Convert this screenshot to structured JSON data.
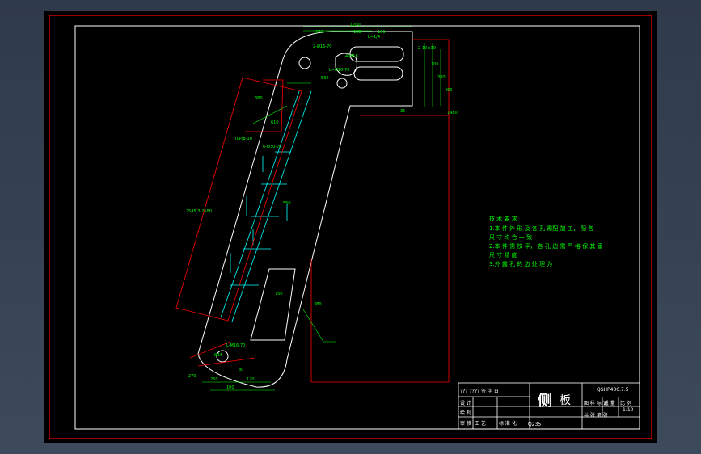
{
  "colors": {
    "sheet_background": "#000000",
    "frame": "#ff0000",
    "outline": "#ffffff",
    "dimension": "#00ff00",
    "hidden_line": "#00ffff",
    "viewport": "#3d4a5c"
  },
  "notes": {
    "heading": "技 术 要 求",
    "lines": [
      "1.本 件 外 形 及 各 孔 需配 加 工， 配 各",
      "尺 寸 均 合 一 致",
      "2.本 件 需 校 平， 各 孔 边 需 严 格 保 其 垂",
      "尺 寸 精 度",
      "3.外 露 孔 的 边 处 理 为"
    ]
  },
  "title_block": {
    "drawing_number": "QSHP400.7.5",
    "part_name_char1": "侧",
    "part_name_char2": "板",
    "label_stage": "图 样 标 记",
    "label_weight": "重 量",
    "label_scale": "比 例",
    "scale": "1:10",
    "sheet_of": "共 张 第 张",
    "design": "设 计",
    "draw": "绘 制",
    "check": "审 核",
    "process": "工 艺",
    "standard": "标 准 化",
    "material": "Q235",
    "misc": "??? ???? 签 字 日"
  },
  "dimensions": [
    "1200",
    "270",
    "188",
    "150",
    "L=1/4",
    "2-10×30",
    "100",
    "380",
    "460",
    "1480",
    "2-Ø16-70",
    "4-M16",
    "L=Ø10-70",
    "530",
    "380",
    "610",
    "2545 3-2580",
    "TLP/8-10",
    "6-Ø30-70",
    "550",
    "750",
    "380",
    "L-M16-70",
    "Ø15",
    "80",
    "260",
    "120",
    "100",
    "270",
    "35"
  ]
}
